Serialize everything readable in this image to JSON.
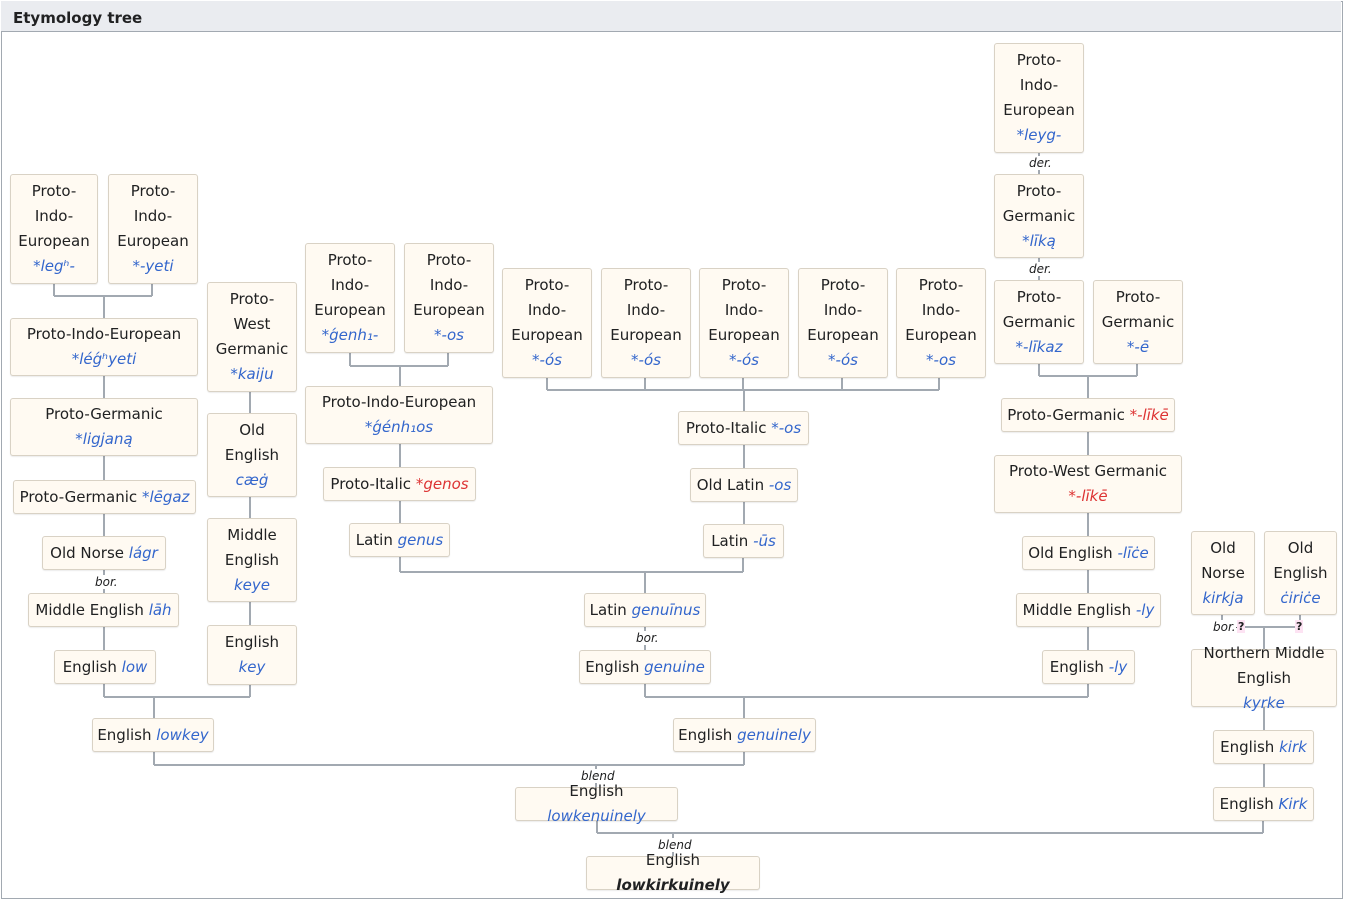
{
  "title": "Etymology tree",
  "nodes": {
    "pie_legh": {
      "lang": "Proto-\nIndo-\nEuropean",
      "term": "*legʰ-"
    },
    "pie_yeti": {
      "lang": "Proto-\nIndo-\nEuropean",
      "term": "*-yeti"
    },
    "pie_leghyeti": {
      "lang": "Proto-Indo-European",
      "term": "*léǵʰyeti"
    },
    "pg_ligjana": {
      "lang": "Proto-Germanic",
      "term": "*ligjaną"
    },
    "pg_legaz": {
      "lang": "Proto-Germanic",
      "term": "*lēgaz"
    },
    "on_lagr": {
      "lang": "Old Norse",
      "term": "lágr"
    },
    "me_lah": {
      "lang": "Middle English",
      "term": "lāh"
    },
    "en_low": {
      "lang": "English",
      "term": "low"
    },
    "pwg_kaiju": {
      "lang": "Proto-\nWest\nGermanic",
      "term": "*kaiju"
    },
    "oe_caeg": {
      "lang": "Old\nEnglish",
      "term": "cæġ"
    },
    "me_keye": {
      "lang": "Middle\nEnglish",
      "term": "keye"
    },
    "en_key": {
      "lang": "English",
      "term": "key"
    },
    "en_lowkey": {
      "lang": "English",
      "term": "lowkey"
    },
    "pie_genh": {
      "lang": "Proto-\nIndo-\nEuropean",
      "term": "*ǵenh₁-"
    },
    "pie_os1": {
      "lang": "Proto-\nIndo-\nEuropean",
      "term": "*-os"
    },
    "pie_genhos": {
      "lang": "Proto-Indo-European",
      "term": "*ǵénh₁os"
    },
    "pit_genos": {
      "lang": "Proto-Italic",
      "term": "*genos"
    },
    "la_genus": {
      "lang": "Latin",
      "term": "genus"
    },
    "pie_os2": {
      "lang": "Proto-\nIndo-\nEuropean",
      "term": "*-ós"
    },
    "pie_os3": {
      "lang": "Proto-\nIndo-\nEuropean",
      "term": "*-ós"
    },
    "pie_os4": {
      "lang": "Proto-\nIndo-\nEuropean",
      "term": "*-ós"
    },
    "pie_os5": {
      "lang": "Proto-\nIndo-\nEuropean",
      "term": "*-ós"
    },
    "pie_os6": {
      "lang": "Proto-\nIndo-\nEuropean",
      "term": "*-os"
    },
    "pit_os": {
      "lang": "Proto-Italic",
      "term": "*-os"
    },
    "ol_os": {
      "lang": "Old Latin",
      "term": "-os"
    },
    "la_us": {
      "lang": "Latin",
      "term": "-ūs"
    },
    "la_genuinus": {
      "lang": "Latin",
      "term": "genuīnus"
    },
    "en_genuine": {
      "lang": "English",
      "term": "genuine"
    },
    "en_genuinely": {
      "lang": "English",
      "term": "genuinely"
    },
    "en_lowkenuinely": {
      "lang": "English",
      "term": "lowkenuinely"
    },
    "en_lowkirkuinely": {
      "lang": "English",
      "term": "lowkirkuinely"
    },
    "pie_leyg": {
      "lang": "Proto-\nIndo-\nEuropean",
      "term": "*leyg-"
    },
    "pg_lika": {
      "lang": "Proto-\nGermanic",
      "term": "*līką"
    },
    "pg_likaz": {
      "lang": "Proto-\nGermanic",
      "term": "*-līkaz"
    },
    "pg_e": {
      "lang": "Proto-\nGermanic",
      "term": "*-ē"
    },
    "pg_like": {
      "lang": "Proto-Germanic",
      "term": "*-līkē"
    },
    "pwg_like": {
      "lang": "Proto-West Germanic",
      "term": "*-līkē"
    },
    "oe_lice": {
      "lang": "Old English",
      "term": "-līċe"
    },
    "me_ly": {
      "lang": "Middle English",
      "term": "-ly"
    },
    "en_ly": {
      "lang": "English",
      "term": "-ly"
    },
    "on_kirkja": {
      "lang": "Old\nNorse",
      "term": "kirkja"
    },
    "oe_cirice": {
      "lang": "Old\nEnglish",
      "term": "ċiriċe"
    },
    "nme_kyrke": {
      "lang": "Northern Middle\nEnglish",
      "term": "kyrke"
    },
    "en_kirk": {
      "lang": "English",
      "term": "kirk"
    },
    "en_Kirk": {
      "lang": "English",
      "term": "Kirk"
    }
  },
  "labels": {
    "bor1": "bor.",
    "bor2": "bor.",
    "bor3": "bor.-",
    "der1": "der.",
    "der2": "der.",
    "blend1": "blend",
    "blend2": "blend",
    "q1": "?",
    "q2": "?"
  },
  "colors": {
    "term": "#3366cc",
    "reconstructed_red": "#d33",
    "node_bg": "#fffaf2",
    "line": "#a2a9b1"
  }
}
